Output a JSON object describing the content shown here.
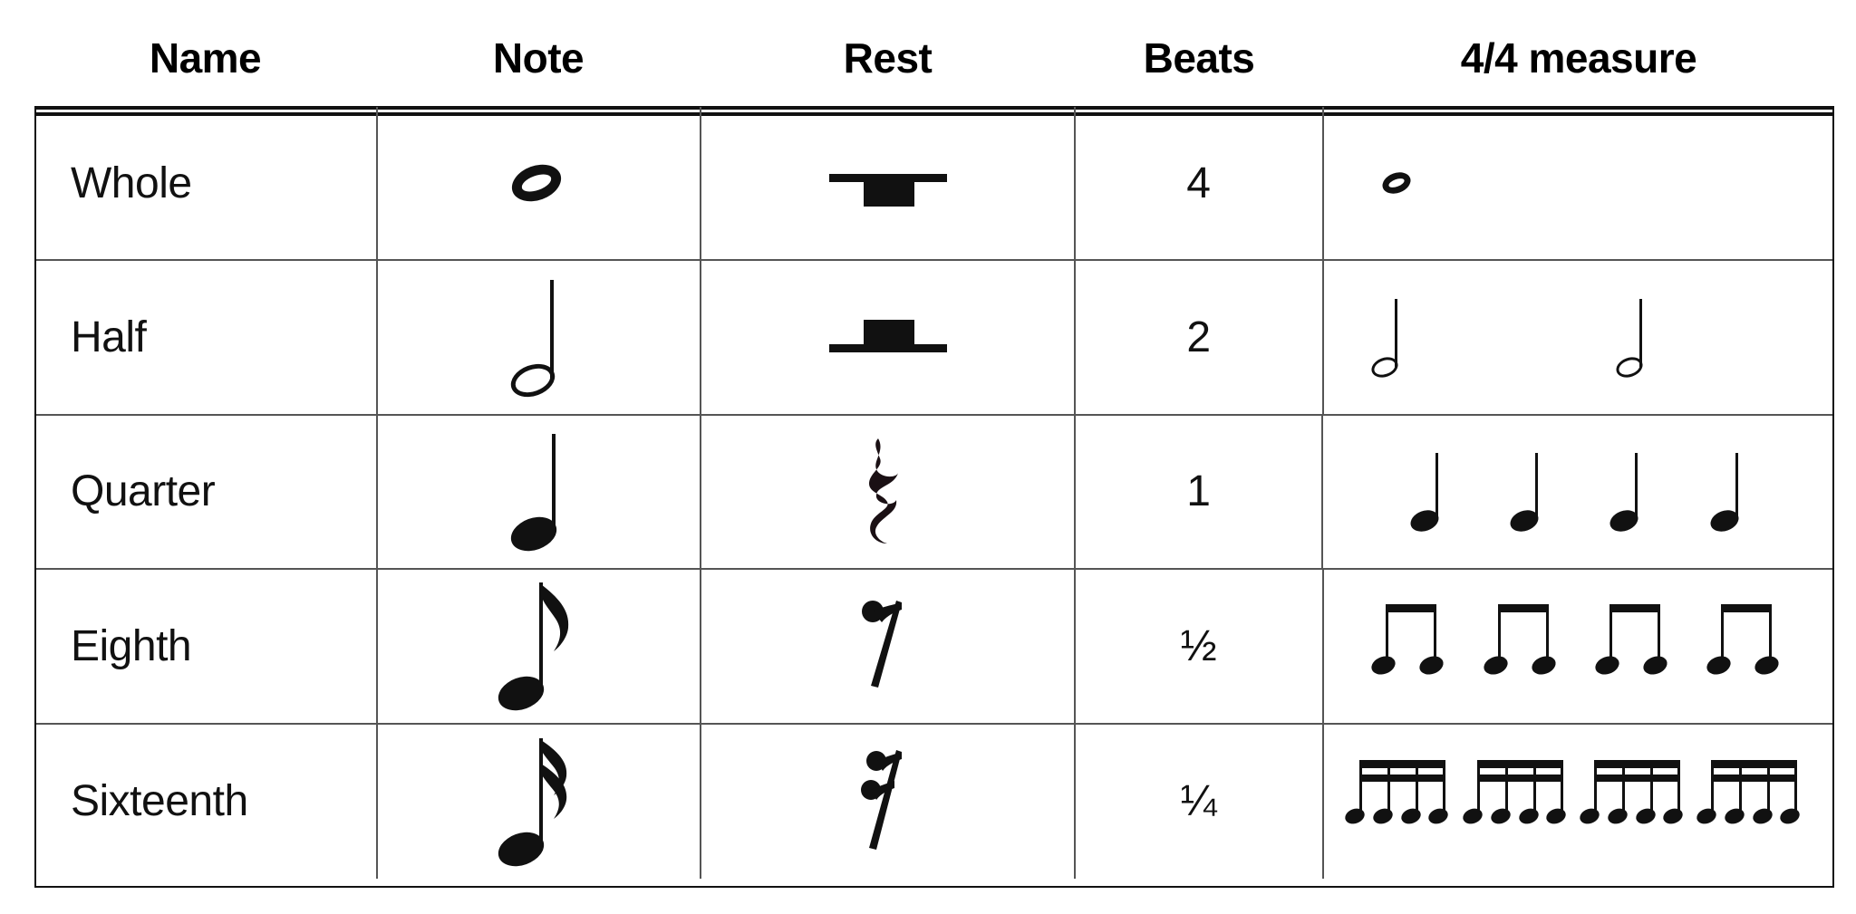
{
  "table": {
    "columns": [
      {
        "key": "name",
        "label": "Name"
      },
      {
        "key": "note",
        "label": "Note"
      },
      {
        "key": "rest",
        "label": "Rest"
      },
      {
        "key": "beats",
        "label": "Beats"
      },
      {
        "key": "measure",
        "label": "4/4 measure"
      }
    ],
    "rows": [
      {
        "name": "Whole",
        "beats": "4",
        "note_icon": "whole-note-symbol",
        "rest_icon": "whole-rest-symbol",
        "measure_icon": "one-whole-note",
        "measure_count": 1,
        "measure_group_size": 1
      },
      {
        "name": "Half",
        "beats": "2",
        "note_icon": "half-note-symbol",
        "rest_icon": "half-rest-symbol",
        "measure_icon": "two-half-notes",
        "measure_count": 2,
        "measure_group_size": 1
      },
      {
        "name": "Quarter",
        "beats": "1",
        "note_icon": "quarter-note-symbol",
        "rest_icon": "quarter-rest-symbol",
        "measure_icon": "four-quarter-notes",
        "measure_count": 4,
        "measure_group_size": 1
      },
      {
        "name": "Eighth",
        "beats": "½",
        "note_icon": "eighth-note-symbol",
        "rest_icon": "eighth-rest-symbol",
        "measure_icon": "four-beamed-eighth-note-pairs",
        "measure_count": 4,
        "measure_group_size": 2
      },
      {
        "name": "Sixteenth",
        "beats": "¼",
        "note_icon": "sixteenth-note-symbol",
        "rest_icon": "sixteenth-rest-symbol",
        "measure_icon": "four-beamed-sixteenth-note-groups",
        "measure_count": 4,
        "measure_group_size": 4
      }
    ]
  },
  "colors": {
    "text": "#111111",
    "background": "#ffffff",
    "border": "#555555",
    "rule": "#111111"
  }
}
